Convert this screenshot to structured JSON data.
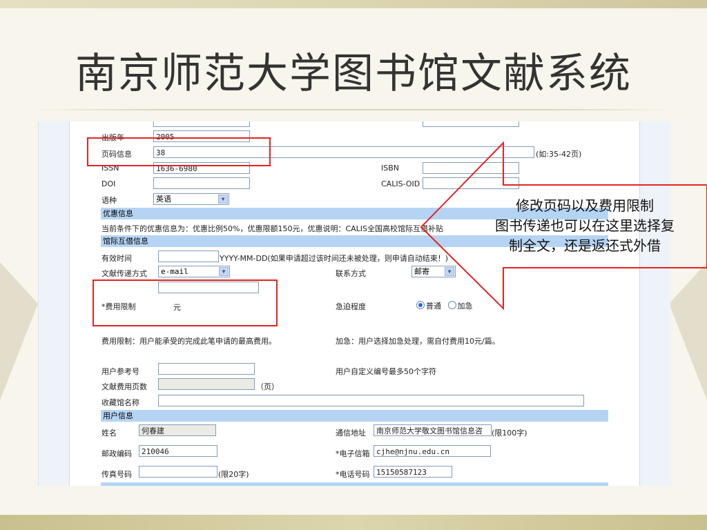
{
  "slide": {
    "title": "南京师范大学图书馆文献系统"
  },
  "form": {
    "publish_year": {
      "label": "出版年",
      "value": "2005"
    },
    "page_info": {
      "label": "页码信息",
      "value": "38",
      "hint": "(如:35-42页)"
    },
    "issn": {
      "label": "ISSN",
      "value": "1636-6980"
    },
    "isbn": {
      "label": "ISBN",
      "value": ""
    },
    "doi": {
      "label": "DOI",
      "value": ""
    },
    "calis_oid": {
      "label": "CALIS-OID",
      "value": ""
    },
    "language": {
      "label": "语种",
      "value": "英语"
    },
    "discount_section": "优惠信息",
    "discount_text": "当前条件下的优惠信息为：优惠比例50%，优惠限额150元，优惠说明：CALIS全国高校馆际互借补贴",
    "ill_section": "馆际互借信息",
    "valid_time": {
      "label": "有效时间",
      "value": "",
      "hint": "YYYY-MM-DD(如果申请超过该时间还未被处理，则申请自动结束！)"
    },
    "delivery": {
      "label": "文献传递方式",
      "value": "e-mail"
    },
    "contact": {
      "label": "联系方式",
      "value": "邮寄"
    },
    "fee_limit": {
      "label": "*费用限制",
      "unit": "元"
    },
    "urgency": {
      "label": "急迫程度",
      "normal": "普通",
      "urgent": "加急",
      "selected": "普通"
    },
    "fee_note": "费用限制：用户能承受的完成此笔申请的最高费用。",
    "urgent_note": "加急：用户选择加急处理，需自付费用10元/篇。",
    "user_ref": {
      "label": "用户参考号",
      "value": "",
      "hint": "用户自定义编号最多50个字符"
    },
    "doc_pages": {
      "label": "文献费用页数",
      "value": "",
      "unit": "（页）"
    },
    "holding_lib": {
      "label": "收藏馆名称",
      "value": ""
    },
    "user_section": "用户信息",
    "name": {
      "label": "姓名",
      "value": "何春建"
    },
    "address": {
      "label": "通信地址",
      "value": "南京师范大学敬文图书馆信息咨",
      "hint": "(限100字)"
    },
    "postcode": {
      "label": "邮政编码",
      "value": "210046"
    },
    "email": {
      "label": "*电子信箱",
      "value": "cjhe@njnu.edu.cn"
    },
    "fax": {
      "label": "传真号码",
      "value": "",
      "hint": "(限20字)"
    },
    "phone": {
      "label": "*电话号码",
      "value": "15150587123"
    }
  },
  "callout": {
    "line1": "修改页码以及费用限制",
    "line2": "图书传递也可以在这里选择复",
    "line3": "制全文，还是返还式外借"
  },
  "colors": {
    "highlight_red": "#e52222",
    "section_band": "#b5d4f4"
  }
}
